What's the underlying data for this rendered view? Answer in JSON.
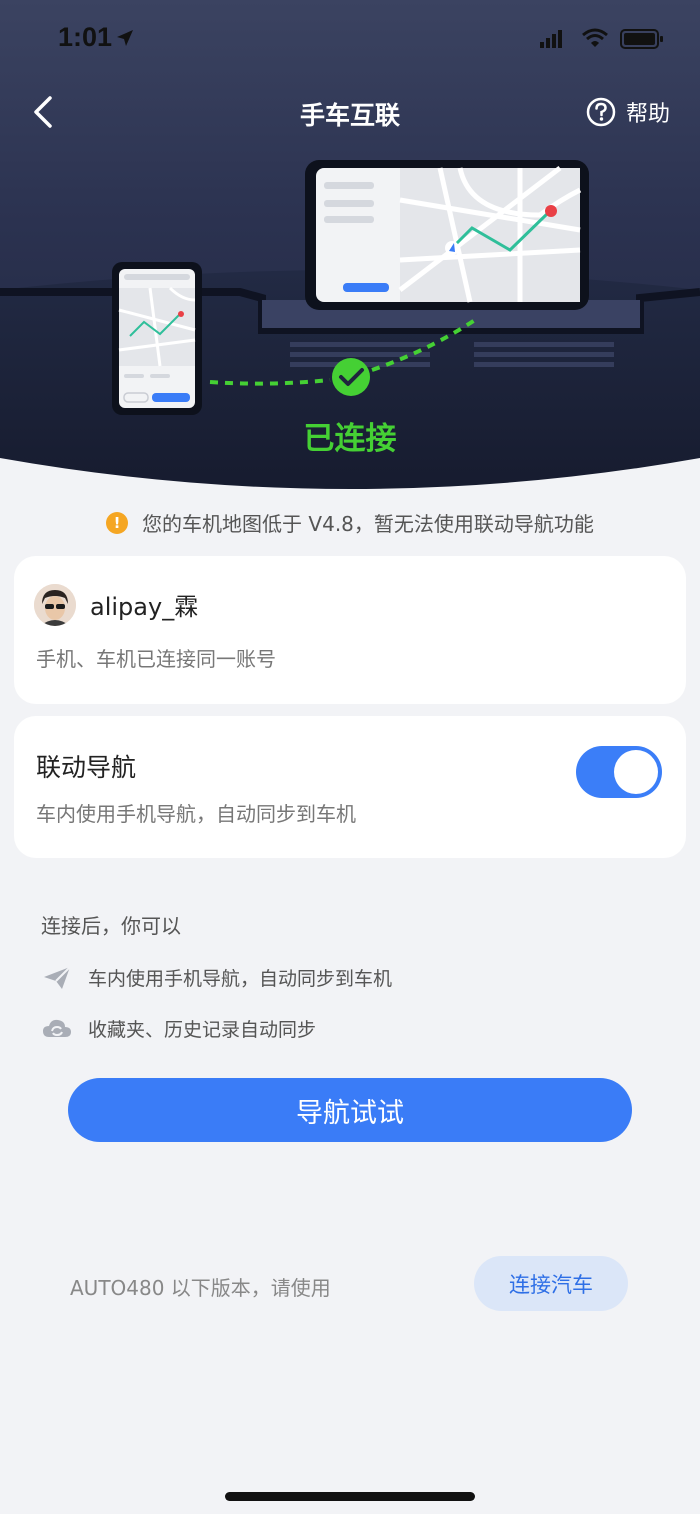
{
  "status_bar": {
    "time": "1:01"
  },
  "header": {
    "title": "手车互联",
    "help_label": "帮助"
  },
  "connection": {
    "status_label": "已连接"
  },
  "warning": {
    "text": "您的车机地图低于 V4.8，暂无法使用联动导航功能"
  },
  "account": {
    "username": "alipay_霖",
    "description": "手机、车机已连接同一账号"
  },
  "linked_navigation": {
    "title": "联动导航",
    "description": "车内使用手机导航，自动同步到车机",
    "enabled": true
  },
  "features": {
    "heading": "连接后，你可以",
    "items": [
      {
        "icon": "paper-plane-icon",
        "label": "车内使用手机导航，自动同步到车机"
      },
      {
        "icon": "cloud-sync-icon",
        "label": "收藏夹、历史记录自动同步"
      }
    ]
  },
  "primary_action": {
    "label": "导航试试"
  },
  "legacy": {
    "text": "AUTO480 以下版本，请使用",
    "button_label": "连接汽车"
  },
  "colors": {
    "accent": "#3a7cf7",
    "connected": "#45d034",
    "warning": "#f5a623"
  }
}
